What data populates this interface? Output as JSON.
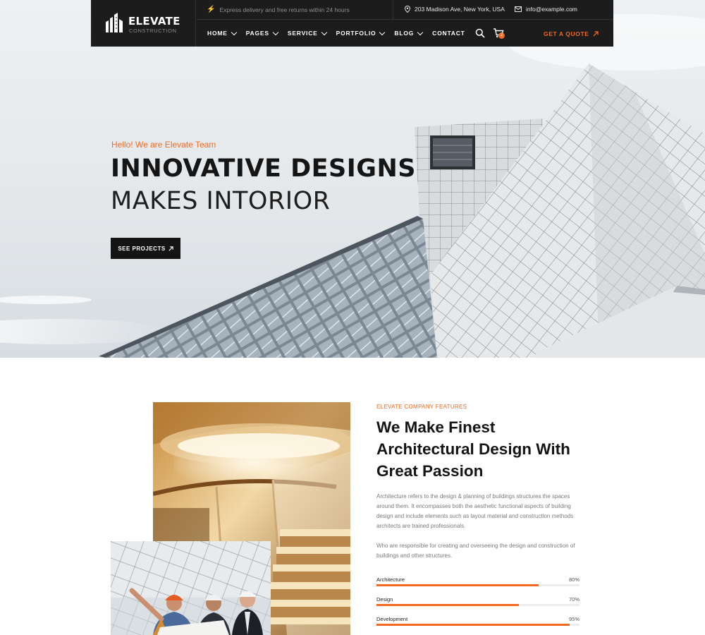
{
  "brand": {
    "name": "ELEVATE",
    "sub": "CONSTRUCTION",
    "accent": "#f26a21",
    "dark": "#1c1c1c"
  },
  "topbar": {
    "promo": "Express delivery and free returns within 24 hours",
    "address": "203 Madison Ave, New York, USA",
    "email": "info@example.com"
  },
  "nav": [
    {
      "label": "HOME",
      "dropdown": true
    },
    {
      "label": "PAGES",
      "dropdown": true
    },
    {
      "label": "SERVICE",
      "dropdown": true
    },
    {
      "label": "PORTFOLIO",
      "dropdown": true
    },
    {
      "label": "BLOG",
      "dropdown": true
    },
    {
      "label": "CONTACT",
      "dropdown": false
    }
  ],
  "cart_count": "2",
  "quote_label": "GET A QUOTE",
  "hero": {
    "eyebrow": "Hello! We are Elevate Team",
    "title_line1": "INNOVATIVE DESIGNS",
    "title_line2": "MAKES INTORIOR",
    "button": "SEE PROJECTS"
  },
  "features": {
    "eyebrow": "ELEVATE COMPANY FEATURES",
    "title": "We Make Finest Architectural Design With Great Passion",
    "p1": "Architecture refers to the design & planning of buildings structures the spaces around them. It encompasses both the aesthetic functional aspects of building design and include elements such as layout material and construction methods architects are trained professionals.",
    "p2": "Who are responsible for creating and overseeing the design and construction of buildings and other structures.",
    "skills": [
      {
        "label": "Architecture",
        "pct_text": "80%",
        "value": 80
      },
      {
        "label": "Design",
        "pct_text": "70%",
        "value": 70
      },
      {
        "label": "Development",
        "pct_text": "95%",
        "value": 95
      }
    ]
  }
}
